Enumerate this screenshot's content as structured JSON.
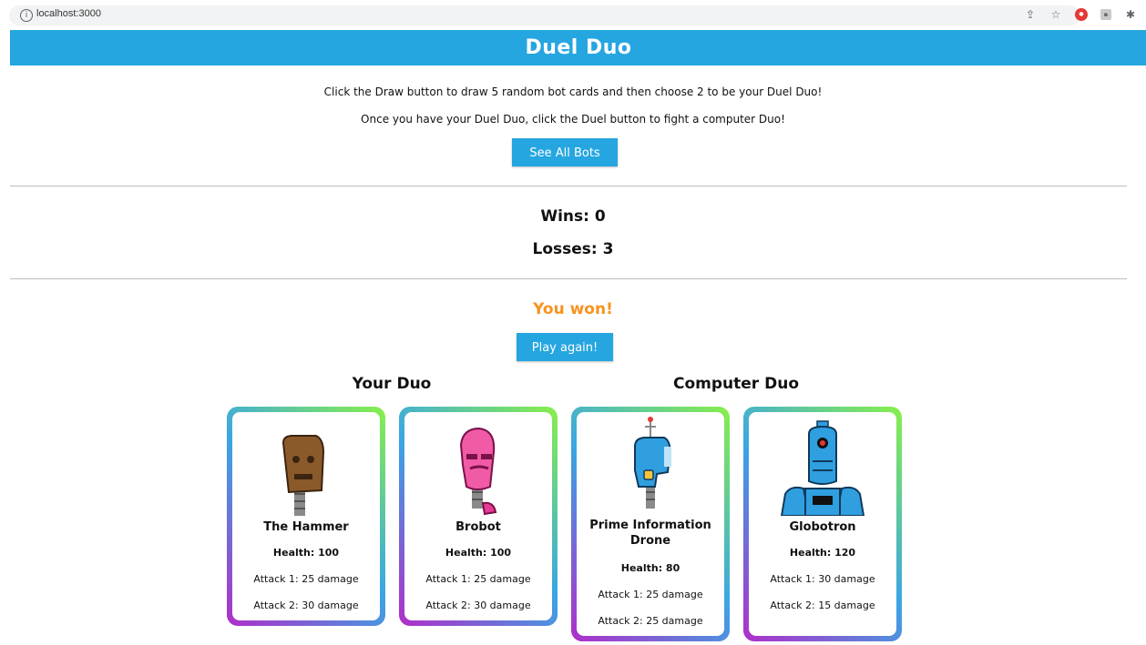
{
  "browser": {
    "url": "localhost:3000"
  },
  "header": {
    "title": "Duel Duo"
  },
  "intro": {
    "line1": "Click the Draw button to draw 5 random bot cards and then choose 2 to be your Duel Duo!",
    "line2": "Once you have your Duel Duo, click the Duel button to fight a computer Duo!"
  },
  "buttons": {
    "see_all": "See All Bots",
    "play_again": "Play again!"
  },
  "stats": {
    "wins": "Wins: 0",
    "losses": "Losses: 3"
  },
  "result": "You won!",
  "your_duo": {
    "title": "Your Duo",
    "cards": [
      {
        "name": "The Hammer",
        "health": "Health: 100",
        "attack1": "Attack 1: 25 damage",
        "attack2": "Attack 2: 30 damage"
      },
      {
        "name": "Brobot",
        "health": "Health: 100",
        "attack1": "Attack 1: 25 damage",
        "attack2": "Attack 2: 30 damage"
      }
    ]
  },
  "computer_duo": {
    "title": "Computer Duo",
    "cards": [
      {
        "name": "Prime Information Drone",
        "health": "Health: 80",
        "attack1": "Attack 1: 25 damage",
        "attack2": "Attack 2: 25 damage"
      },
      {
        "name": "Globotron",
        "health": "Health: 120",
        "attack1": "Attack 1: 30 damage",
        "attack2": "Attack 2: 15 damage"
      }
    ]
  },
  "colors": {
    "primary": "#26a6e0",
    "result": "#f7931e"
  },
  "icons": [
    "info-icon",
    "share-icon",
    "star-icon",
    "extension-icon",
    "puzzle-icon"
  ]
}
